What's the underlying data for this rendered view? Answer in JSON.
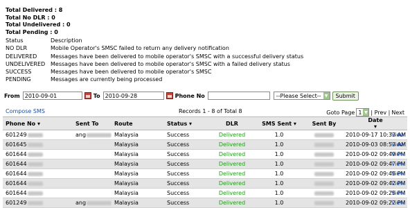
{
  "totals": [
    "Total Delivered : 8",
    "Total No DLR : 0",
    "Total Undelivered : 0",
    "Total Pending : 0"
  ],
  "legend": {
    "header": {
      "status": "Status",
      "description": "Description"
    },
    "rows": [
      {
        "status": "NO DLR",
        "description": "Mobile Operator's SMSC failed to return any delivery notification"
      },
      {
        "status": "DELIVERED",
        "description": "Messages have been delivered to mobile operator's SMSC with a successful delivery status"
      },
      {
        "status": "UNDELIVERED",
        "description": "Messages have been delivered to mobile operator's SMSC with a failed delivery status"
      },
      {
        "status": "SUCCESS",
        "description": "Messages have been delivered to mobile operator's SMSC"
      },
      {
        "status": "PENDING",
        "description": "Messages are currently being processed"
      }
    ]
  },
  "filter": {
    "from_label": "From",
    "from_value": "2010-09-01",
    "to_label": "To",
    "to_value": "2010-09-28",
    "phone_label": "Phone No",
    "phone_value": "",
    "select_value": "--Please Select--",
    "submit_label": "Submit"
  },
  "toolbar": {
    "compose_label": "Compose SMS",
    "records_label": "Records 1 - 8 of Total 8",
    "goto_label": "Goto Page",
    "page_value": "1",
    "prev_label": "| Prev |",
    "next_label": "Next"
  },
  "table": {
    "headers": [
      "Phone No ▾",
      "Sent To",
      "Route",
      "Status ▾",
      "DLR",
      "SMS Sent ▾",
      "Sent By",
      "Date ▾",
      ""
    ],
    "rows": [
      {
        "phone": "601249",
        "sent_to": "ang",
        "route": "Malaysia",
        "status": "Success",
        "dlr": "Delivered",
        "sms_sent": "1.0",
        "date": "2010-09-17 10:33 AM",
        "view": "View"
      },
      {
        "phone": "601645",
        "sent_to": "",
        "route": "Malaysia",
        "status": "Success",
        "dlr": "Delivered",
        "sms_sent": "1.0",
        "date": "2010-09-03 08:53 AM",
        "view": "View"
      },
      {
        "phone": "601644",
        "sent_to": "",
        "route": "Malaysia",
        "status": "Success",
        "dlr": "Delivered",
        "sms_sent": "1.0",
        "date": "2010-09-02 09:49 PM",
        "view": "View"
      },
      {
        "phone": "601644",
        "sent_to": "",
        "route": "Malaysia",
        "status": "Success",
        "dlr": "Delivered",
        "sms_sent": "1.0",
        "date": "2010-09-02 09:47 PM",
        "view": "View"
      },
      {
        "phone": "601644",
        "sent_to": "",
        "route": "Malaysia",
        "status": "Success",
        "dlr": "Delivered",
        "sms_sent": "1.0",
        "date": "2010-09-02 09:45 PM",
        "view": "View"
      },
      {
        "phone": "601644",
        "sent_to": "",
        "route": "Malaysia",
        "status": "Success",
        "dlr": "Delivered",
        "sms_sent": "1.0",
        "date": "2010-09-02 09:42 PM",
        "view": "View"
      },
      {
        "phone": "601644",
        "sent_to": "",
        "route": "Malaysia",
        "status": "Success",
        "dlr": "Delivered",
        "sms_sent": "1.0",
        "date": "2010-09-02 09:25 PM",
        "view": "View"
      },
      {
        "phone": "601249",
        "sent_to": "ang",
        "route": "Malaysia",
        "status": "Success",
        "dlr": "Delivered",
        "sms_sent": "1.0",
        "date": "2010-09-02 09:22 PM",
        "view": "View"
      }
    ]
  }
}
